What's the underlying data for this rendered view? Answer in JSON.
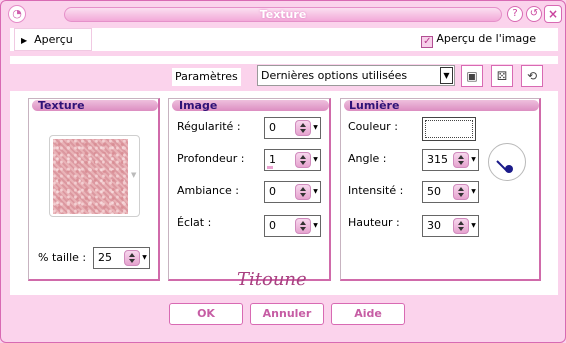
{
  "window": {
    "title": "Texture"
  },
  "preview": {
    "toggle_label": "Aperçu",
    "image_preview_label": "Aperçu de l'image",
    "image_preview_checked": true
  },
  "params": {
    "label": "Paramètres",
    "preset_value": "Dernières options utilisées",
    "icons": [
      "save-preset-icon",
      "random-dice-icon",
      "reset-icon"
    ]
  },
  "texture": {
    "title": "Texture",
    "size_label": "% taille :",
    "size_value": "25"
  },
  "image": {
    "title": "Image",
    "fields": [
      {
        "label": "Régularité :",
        "value": "0"
      },
      {
        "label": "Profondeur :",
        "value": "1"
      },
      {
        "label": "Ambiance :",
        "value": "0"
      },
      {
        "label": "Éclat :",
        "value": "0"
      }
    ]
  },
  "light": {
    "title": "Lumière",
    "color_label": "Couleur :",
    "color_value": "#ffffff",
    "angle_label": "Angle :",
    "angle_value": "315",
    "intensity_label": "Intensité :",
    "intensity_value": "50",
    "height_label": "Hauteur :",
    "height_value": "30"
  },
  "signature": "Titoune",
  "buttons": {
    "ok": "OK",
    "cancel": "Annuler",
    "help": "Aide"
  },
  "colors": {
    "window_bg": "#fbd3ec",
    "accent": "#d86ab3",
    "group_title": "#2f1277"
  }
}
